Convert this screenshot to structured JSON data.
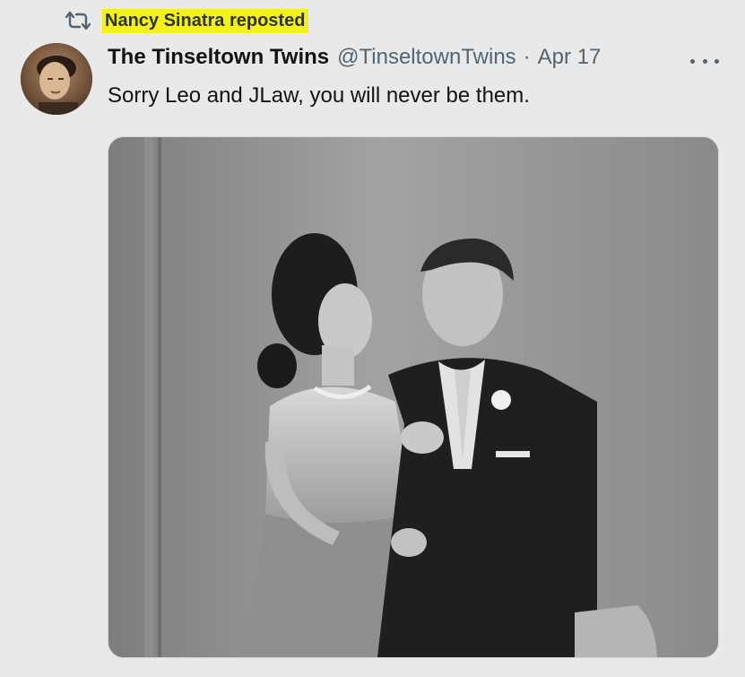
{
  "repost": {
    "label": "Nancy Sinatra reposted",
    "icon": "repost-icon",
    "highlight_color": "#f2f21a"
  },
  "tweet": {
    "display_name": "The Tinseltown Twins",
    "handle": "@TinseltownTwins",
    "separator": "·",
    "date": "Apr 17",
    "text": "Sorry Leo and JLaw, you will never be them.",
    "more_icon": "more-horizontal-icon"
  },
  "media": {
    "kind": "black-and-white photograph"
  },
  "colors": {
    "background": "#e9e9ea",
    "text_primary": "#0f1419",
    "text_secondary": "#536471"
  }
}
